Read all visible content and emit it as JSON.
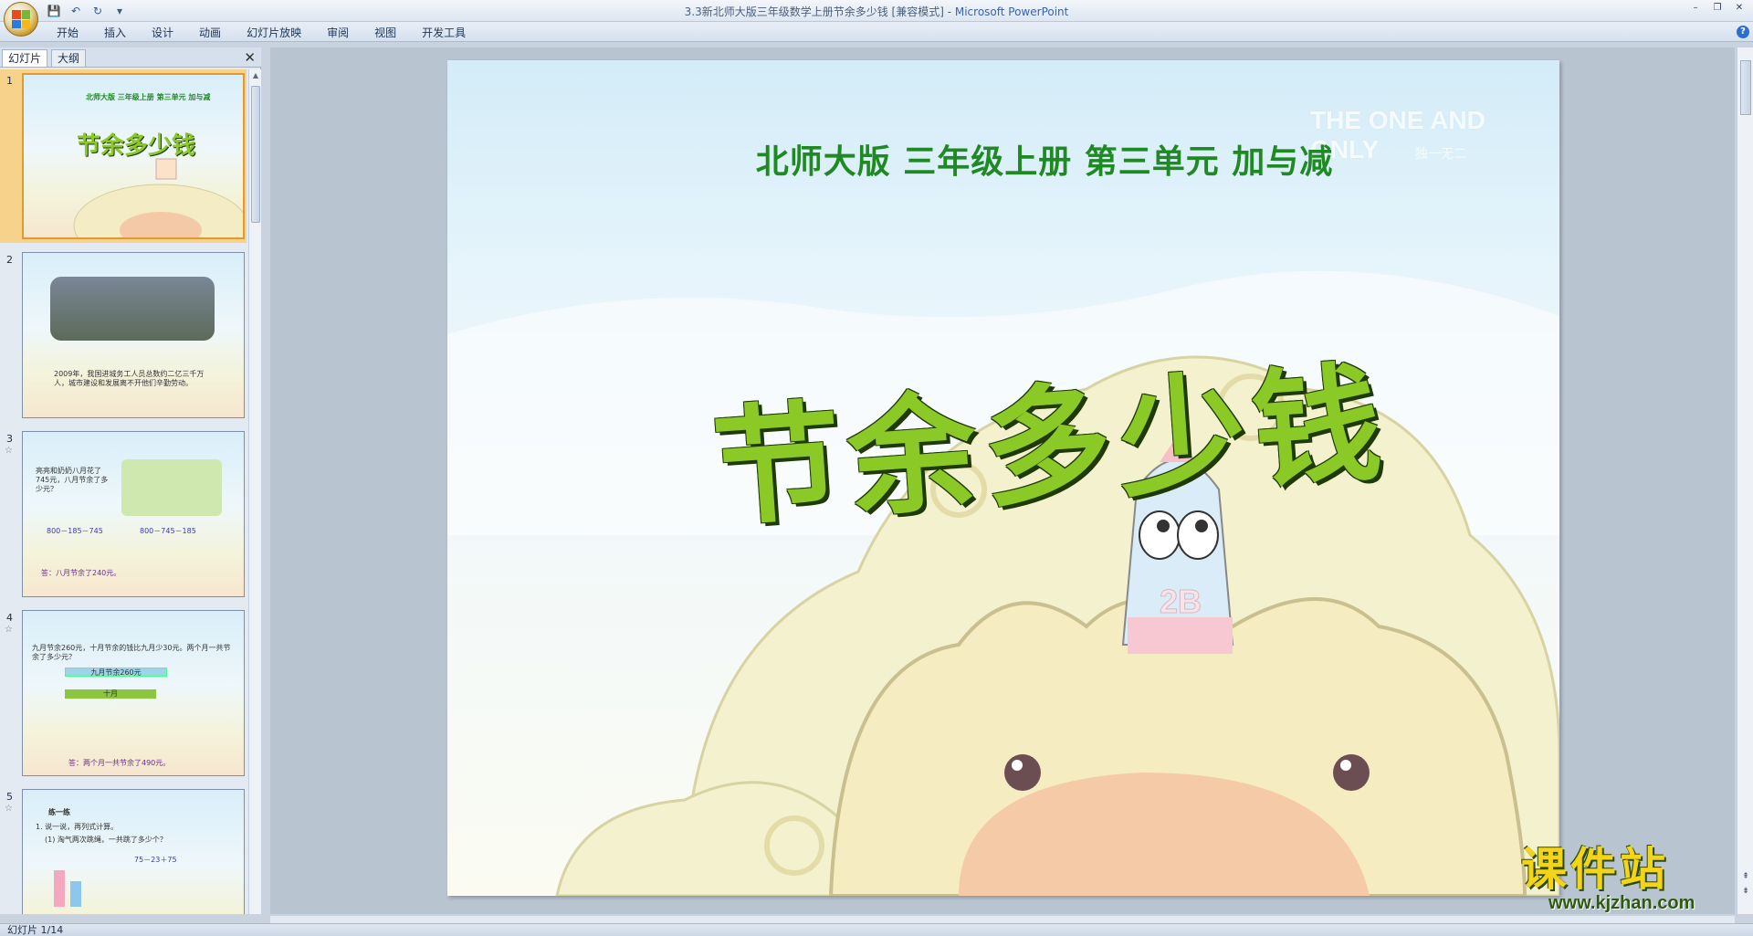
{
  "window": {
    "title": "3.3新北师大版三年级数学上册节余多少钱 [兼容模式] - ",
    "app_name": "Microsoft PowerPoint",
    "controls": [
      "–",
      "❐",
      "✕"
    ]
  },
  "qat": {
    "save": "💾",
    "undo": "↶",
    "redo": "↻",
    "more": "▾"
  },
  "ribbon": {
    "tabs": [
      "开始",
      "插入",
      "设计",
      "动画",
      "幻灯片放映",
      "审阅",
      "视图",
      "开发工具"
    ],
    "help": "?"
  },
  "left_panel": {
    "tabs": [
      "幻灯片",
      "大纲"
    ],
    "close": "✕",
    "slides": [
      {
        "number": "1",
        "star": "",
        "header": "北师大版 三年级上册 第三单元 加与减",
        "title": "节余多少钱"
      },
      {
        "number": "2",
        "star": "",
        "caption": "2009年，我国进城务工人员总数约二亿三千万人，城市建设和发展离不开他们辛勤劳动。"
      },
      {
        "number": "3",
        "star": "☆",
        "question": "亮亮和奶奶八月花了745元，八月节余了多少元？",
        "calc1": "800－185－745",
        "calc2": "800－745－185",
        "answer": "答：八月节余了240元。"
      },
      {
        "number": "4",
        "star": "☆",
        "question": "九月节余260元，十月节余的钱比九月少30元。两个月一共节余了多少元？",
        "label_sep": "九月节余260元",
        "label_oct": "十月",
        "answer": "答：两个月一共节余了490元。"
      },
      {
        "number": "5",
        "star": "☆",
        "heading": "练一练",
        "question": "1. 说一说，再列式计算。",
        "sub": "(1) 淘气两次跳绳，一共跳了多少个？",
        "calc": "75－23＋75"
      }
    ]
  },
  "slide": {
    "subtitle": "北师大版  三年级上册  第三单元  加与减",
    "title": "节余多少钱",
    "watermark": "THE ONE AND ONLY",
    "watermark_sub": "独一无二"
  },
  "status": {
    "slide_info": "幻灯片 1/14"
  },
  "site_logo": {
    "name": "课件站",
    "url": "www.kjzhan.com"
  }
}
